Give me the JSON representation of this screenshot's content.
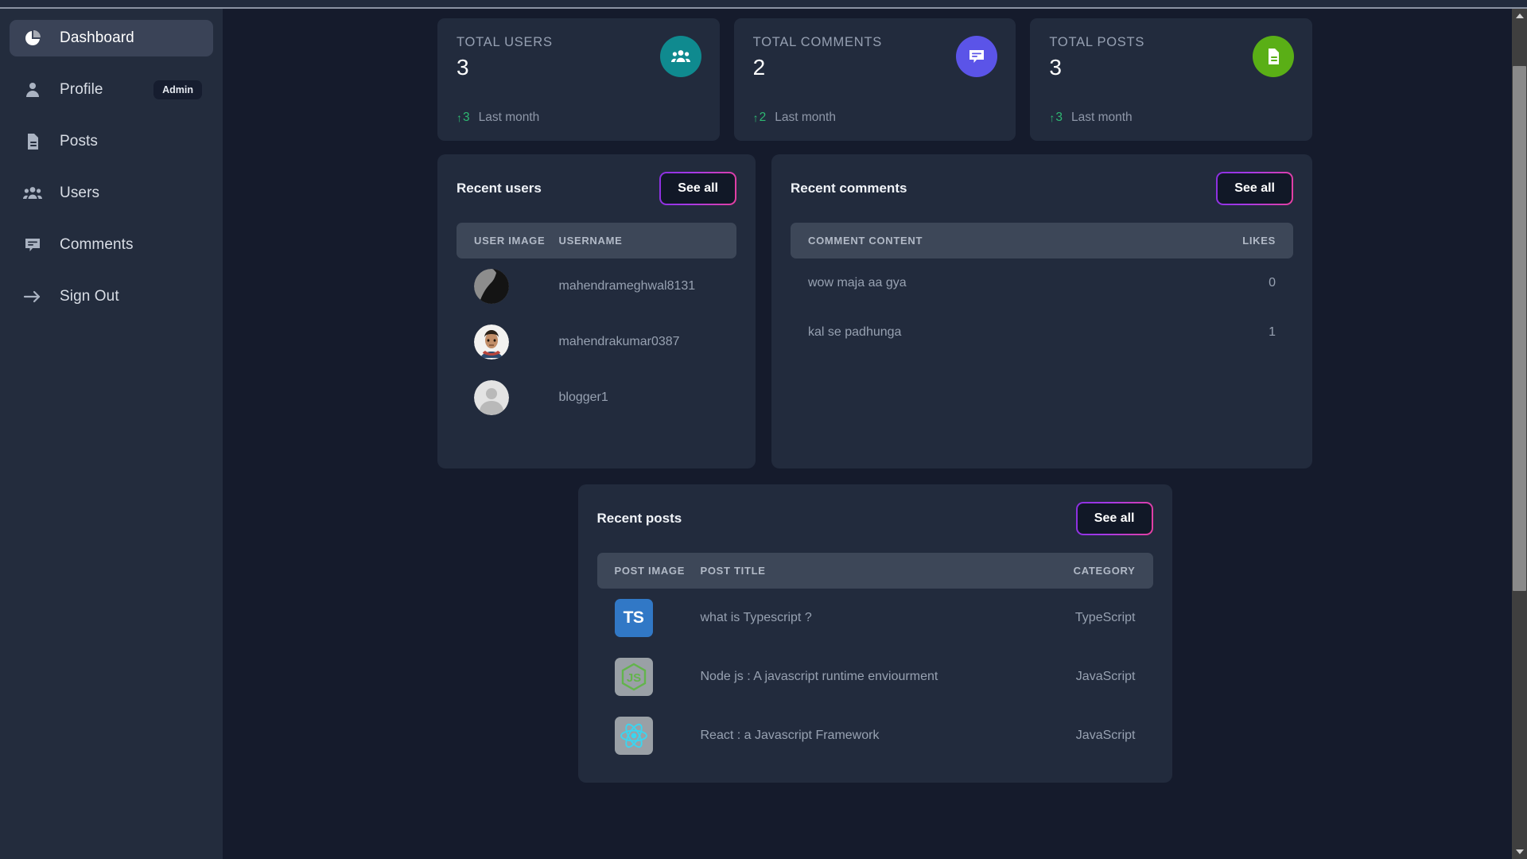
{
  "sidebar": {
    "items": [
      {
        "label": "Dashboard",
        "icon": "pie-chart-icon",
        "active": true,
        "badge": ""
      },
      {
        "label": "Profile",
        "icon": "user-icon",
        "active": false,
        "badge": "Admin"
      },
      {
        "label": "Posts",
        "icon": "document-icon",
        "active": false,
        "badge": ""
      },
      {
        "label": "Users",
        "icon": "users-icon",
        "active": false,
        "badge": ""
      },
      {
        "label": "Comments",
        "icon": "comment-icon",
        "active": false,
        "badge": ""
      },
      {
        "label": "Sign Out",
        "icon": "arrow-right-icon",
        "active": false,
        "badge": ""
      }
    ]
  },
  "stats": [
    {
      "label": "TOTAL USERS",
      "value": "3",
      "delta": "3",
      "delta_arrow": "↑",
      "since": "Last month",
      "icon": "users-icon",
      "color": "#0f8a8f"
    },
    {
      "label": "TOTAL COMMENTS",
      "value": "2",
      "delta": "2",
      "delta_arrow": "↑",
      "since": "Last month",
      "icon": "comment-icon",
      "color": "#5b54e8"
    },
    {
      "label": "TOTAL POSTS",
      "value": "3",
      "delta": "3",
      "delta_arrow": "↑",
      "since": "Last month",
      "icon": "document-icon",
      "color": "#5aaf16"
    }
  ],
  "recent_users": {
    "title": "Recent users",
    "see_all": "See all",
    "columns": [
      "USER IMAGE",
      "USERNAME"
    ],
    "rows": [
      {
        "username": "mahendrameghwal8131",
        "avatar": "photo-dark"
      },
      {
        "username": "mahendrakumar0387",
        "avatar": "photo-person"
      },
      {
        "username": "blogger1",
        "avatar": "default-avatar"
      }
    ]
  },
  "recent_comments": {
    "title": "Recent comments",
    "see_all": "See all",
    "columns": [
      "COMMENT CONTENT",
      "LIKES"
    ],
    "rows": [
      {
        "content": "wow maja aa gya",
        "likes": "0"
      },
      {
        "content": "kal se padhunga",
        "likes": "1"
      }
    ]
  },
  "recent_posts": {
    "title": "Recent posts",
    "see_all": "See all",
    "columns": [
      "POST IMAGE",
      "POST TITLE",
      "CATEGORY"
    ],
    "rows": [
      {
        "title": "what is Typescript ?",
        "category": "TypeScript",
        "thumb": "typescript-logo"
      },
      {
        "title": "Node js : A javascript runtime enviourment",
        "category": "JavaScript",
        "thumb": "nodejs-logo"
      },
      {
        "title": "React : a Javascript Framework",
        "category": "JavaScript",
        "thumb": "react-logo"
      }
    ]
  },
  "colors": {
    "page_bg": "#151b2c",
    "sidebar_bg": "#232c3d",
    "panel_bg": "#222b3d",
    "table_header_bg": "#3d4758",
    "accent_start": "#8b2fe0",
    "accent_end": "#e53fa0",
    "delta_green": "#2eb872"
  }
}
